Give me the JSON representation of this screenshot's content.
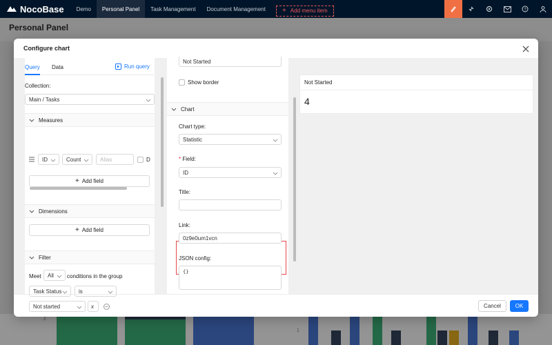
{
  "app": {
    "logo_text": "NocoBase"
  },
  "nav": {
    "items": [
      {
        "label": "Demo",
        "active": false
      },
      {
        "label": "Personal Panel",
        "active": true
      },
      {
        "label": "Task Management",
        "active": false
      },
      {
        "label": "Document Management",
        "active": false
      }
    ],
    "add_menu_label": "Add menu item",
    "right_icons": [
      "brush-icon",
      "plugin-icon",
      "settings-icon",
      "mail-icon",
      "help-icon",
      "user-icon"
    ]
  },
  "page": {
    "title": "Personal Panel"
  },
  "background_chart": {
    "ticks": [
      "2",
      "1"
    ]
  },
  "modal": {
    "title": "Configure chart",
    "query_panel": {
      "tabs": [
        {
          "label": "Query",
          "active": true
        },
        {
          "label": "Data",
          "active": false
        }
      ],
      "run_query_label": "Run query",
      "collection_label": "Collection",
      "collection_value": "Main / Tasks",
      "measures": {
        "title": "Measures",
        "field": "ID",
        "aggregation": "Count",
        "alias_placeholder": "Alias",
        "distinct_label": "D",
        "add_field_label": "Add field"
      },
      "dimensions": {
        "title": "Dimensions",
        "add_field_label": "Add field"
      },
      "filter": {
        "title": "Filter",
        "meet_label": "Meet",
        "meet_value": "All",
        "conditions_label": "conditions in the group",
        "field": "Task Status",
        "operator": "is",
        "value": "Not started"
      }
    },
    "chart_panel": {
      "top_field_value": "Not Started",
      "show_border_label": "Show border",
      "chart_section_title": "Chart",
      "chart_type_label": "Chart type",
      "chart_type_value": "Statistic",
      "field_label": "Field",
      "field_value": "ID",
      "title_label": "Title",
      "title_value": "",
      "link_label": "Link",
      "link_value": "0z9e0um1vcn",
      "json_config_label": "JSON config",
      "json_config_value": "{}"
    },
    "preview": {
      "title": "Not Started",
      "value": "4"
    },
    "footer": {
      "cancel_label": "Cancel",
      "ok_label": "OK"
    }
  },
  "colors": {
    "primary": "#1677ff",
    "nav_bg": "#001529",
    "accent": "#f07044",
    "highlight_border": "#e5484d"
  }
}
